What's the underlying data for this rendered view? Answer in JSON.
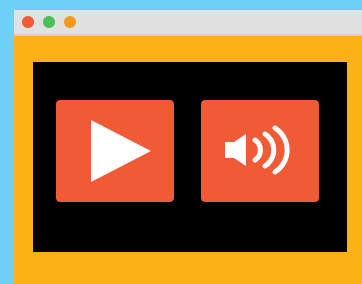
{
  "colors": {
    "backdrop": "#6dd0f7",
    "window_frame": "#fbb217",
    "titlebar": "#e1e1e1",
    "titlebar_divider": "#cfcfcf",
    "screen": "#000000",
    "button": "#f05a35",
    "icon": "#ffffff",
    "dot_red": "#f05a35",
    "dot_green": "#4bbf5a",
    "dot_orange": "#f39a1e"
  },
  "icons": {
    "play": "play-icon",
    "volume": "speaker-volume-icon"
  }
}
